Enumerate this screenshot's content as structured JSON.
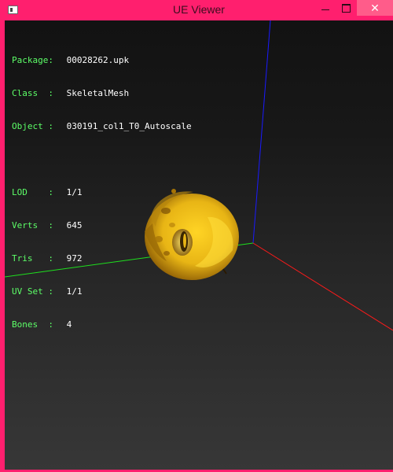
{
  "window": {
    "title": "UE Viewer",
    "icon": "app-icon",
    "controls": {
      "minimize": "minimize-icon",
      "maximize": "maximize-icon",
      "close": "✕"
    },
    "frame_color": "#ff1f6e"
  },
  "info": {
    "package": {
      "label": "Package:",
      "value": "00028262.upk"
    },
    "class": {
      "label": "Class  :",
      "value": "SkeletalMesh"
    },
    "object": {
      "label": "Object :",
      "value": "030191_col1_T0_Autoscale"
    },
    "lod": {
      "label": "LOD    :",
      "value": "1/1"
    },
    "verts": {
      "label": "Verts  :",
      "value": "645"
    },
    "tris": {
      "label": "Tris   :",
      "value": "972"
    },
    "uvset": {
      "label": "UV Set :",
      "value": "1/1"
    },
    "bones": {
      "label": "Bones  :",
      "value": "4"
    }
  },
  "colors": {
    "label": "#5dff68",
    "value": "#ffffff",
    "axis_x": "#ff1a1a",
    "axis_y": "#1ee01e",
    "axis_z": "#1a1aff",
    "mesh": "#e8b515"
  }
}
